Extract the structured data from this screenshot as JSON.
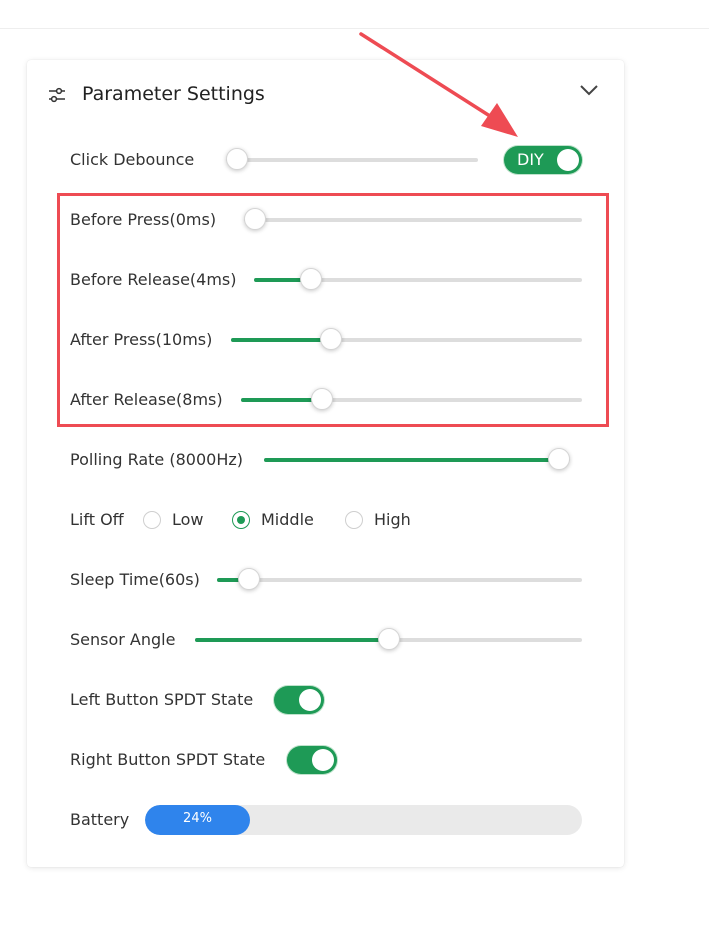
{
  "panel": {
    "title": "Parameter Settings",
    "icons": {
      "settings": "sliders-icon",
      "collapse": "chevron-down-icon"
    }
  },
  "click_debounce": {
    "label": "Click Debounce",
    "slider_value": 0,
    "diy_label": "DIY",
    "diy_on": true
  },
  "debounce_detail": [
    {
      "label": "Before Press(0ms)",
      "value": 0
    },
    {
      "label": "Before Release(4ms)",
      "value": 0.15
    },
    {
      "label": "After Press(10ms)",
      "value": 0.27
    },
    {
      "label": "After Release(8ms)",
      "value": 0.22
    }
  ],
  "polling_rate": {
    "label": "Polling Rate (8000Hz)",
    "value": 1
  },
  "lift_off": {
    "label": "Lift Off",
    "options": [
      "Low",
      "Middle",
      "High"
    ],
    "selected": "Middle"
  },
  "sleep_time": {
    "label": "Sleep Time(60s)",
    "value": 0.06
  },
  "sensor_angle": {
    "label": "Sensor Angle",
    "value": 0.5
  },
  "left_spdt": {
    "label": "Left Button SPDT State",
    "on": true
  },
  "right_spdt": {
    "label": "Right Button SPDT State",
    "on": true
  },
  "battery": {
    "label": "Battery",
    "percent": 24,
    "text": "24%"
  },
  "colors": {
    "accent_green": "#1e9a56",
    "battery_blue": "#2f84ec",
    "annotation_red": "#ee4b53"
  }
}
